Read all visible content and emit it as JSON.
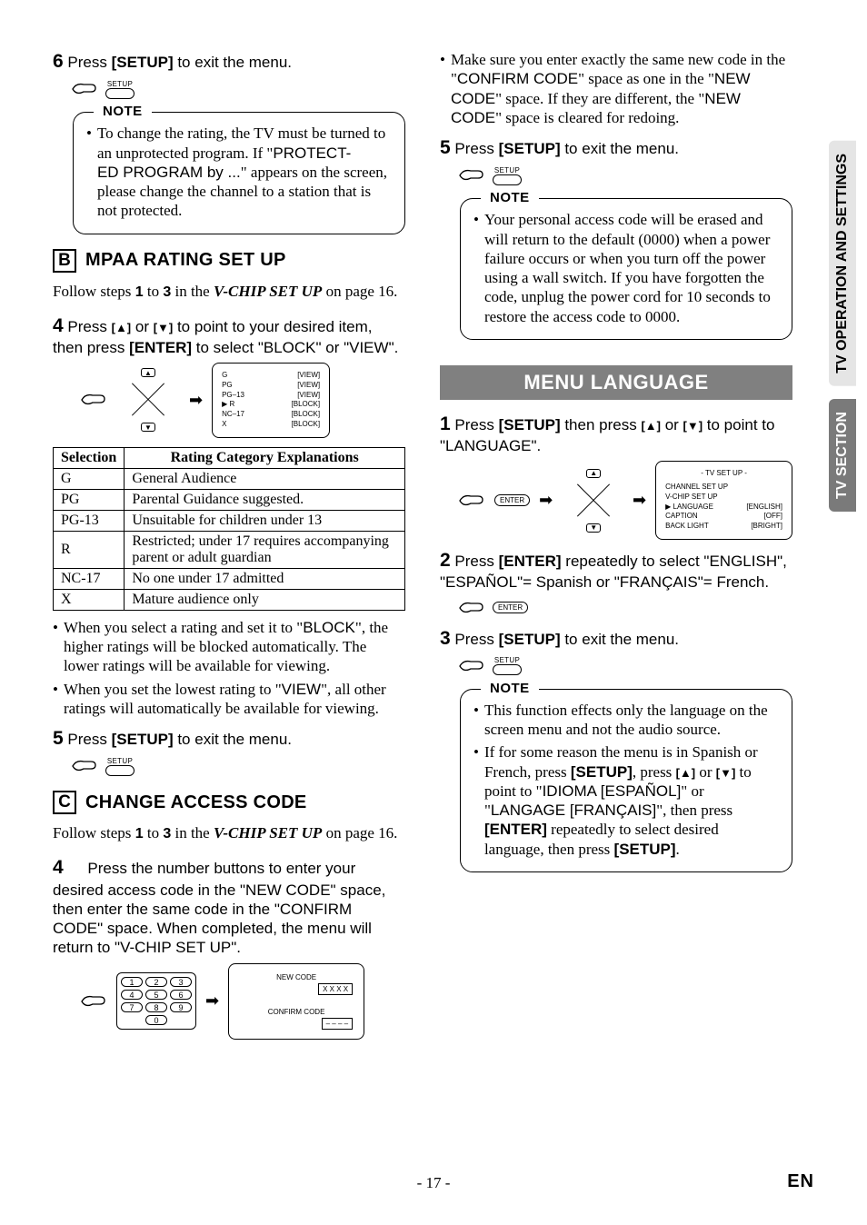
{
  "left": {
    "step6": {
      "num": "6",
      "prefix": "Press ",
      "setup": "[SETUP]",
      "suffix": " to exit the menu."
    },
    "setup_label": "SETUP",
    "note1": {
      "title": "NOTE",
      "body_pre": "To change the rating, the TV must be turned to an unprotected program. If \"",
      "prot1": "PROTECT-",
      "prot2": "ED PROGRAM by ...",
      "body_post": "\" appears on the screen, please change the channel to a station that is not protected."
    },
    "sectionB": {
      "letter": "B",
      "title": "MPAA RATING SET UP"
    },
    "follow": {
      "pre": "Follow steps ",
      "a": "1",
      "mid": " to ",
      "b": "3",
      "mid2": " in the ",
      "vchip": "V-CHIP SET UP",
      "post": " on page 16."
    },
    "step4": {
      "num": "4",
      "line1a": "Press ",
      "up": "[▲]",
      "or": " or ",
      "down": "[▼]",
      "line1b": " to point to your desired item, then press ",
      "enter": "[ENTER]",
      "line1c": " to select \"BLOCK\" or \"VIEW\"."
    },
    "ratings_screen": [
      [
        "G",
        "[VIEW]"
      ],
      [
        "PG",
        "[VIEW]"
      ],
      [
        "PG–13",
        "[VIEW]"
      ],
      [
        "R",
        "[BLOCK]"
      ],
      [
        "NC–17",
        "[BLOCK]"
      ],
      [
        "X",
        "[BLOCK]"
      ]
    ],
    "table": {
      "head": [
        "Selection",
        "Rating Category Explanations"
      ],
      "rows": [
        [
          "G",
          "General Audience"
        ],
        [
          "PG",
          "Parental Guidance suggested."
        ],
        [
          "PG-13",
          "Unsuitable for children under 13"
        ],
        [
          "R",
          "Restricted; under 17 requires accompanying parent or adult guardian"
        ],
        [
          "NC-17",
          "No one under 17 admitted"
        ],
        [
          "X",
          "Mature audience only"
        ]
      ]
    },
    "bullets_after_table": [
      {
        "pre": "When you select a rating and set it to \"",
        "b": "BLOCK",
        "post": "\", the higher ratings will be blocked automatically. The lower ratings will be available for viewing."
      },
      {
        "pre": "When you set the lowest rating to \"",
        "b": "VIEW",
        "post": "\", all other ratings will automatically be available for viewing."
      }
    ],
    "step5": {
      "num": "5",
      "prefix": "Press ",
      "setup": "[SETUP]",
      "suffix": " to exit the menu."
    },
    "sectionC": {
      "letter": "C",
      "title": "CHANGE ACCESS CODE"
    },
    "step4c": {
      "num": "4",
      "text": "Press the number buttons to enter your desired access code in the \"NEW CODE\" space, then enter the same code in the \"CONFIRM CODE\" space. When completed, the menu will return to \"V-CHIP SET UP\"."
    },
    "keypad": [
      "1",
      "2",
      "3",
      "4",
      "5",
      "6",
      "7",
      "8",
      "9",
      "0"
    ],
    "code_screen": {
      "new_label": "NEW CODE",
      "new_value": "X X X X",
      "confirm_label": "CONFIRM CODE",
      "confirm_value": "– – – –"
    }
  },
  "right": {
    "top_bullet": {
      "pre": "Make sure you enter exactly the same new code in the \"",
      "cc": "CONFIRM CODE",
      "mid": "\" space as one in the \"",
      "nc1": "NEW CODE",
      "mid2": "\" space. If they are different, the \"",
      "nc2": "NEW CODE",
      "post": "\" space is cleared for redoing."
    },
    "step5": {
      "num": "5",
      "prefix": "Press ",
      "setup": "[SETUP]",
      "suffix": " to exit the menu."
    },
    "note": {
      "title": "NOTE",
      "body": "Your personal access code will be erased and will return to the default (0000) when a power failure occurs or when you turn off the power using a wall switch. If you have forgotten the code, unplug the power cord for 10 seconds to restore the access code to 0000."
    },
    "banner": "MENU LANGUAGE",
    "step1": {
      "num": "1",
      "pre": "Press ",
      "setup": "[SETUP]",
      "mid": " then press ",
      "up": "[▲]",
      "or": " or ",
      "down": "[▼]",
      "post": " to point to \"LANGUAGE\"."
    },
    "enter_label": "ENTER",
    "tv_screen": {
      "title": "- TV SET UP -",
      "rows": [
        [
          "CHANNEL SET UP",
          ""
        ],
        [
          "V-CHIP SET UP",
          ""
        ],
        [
          "LANGUAGE",
          "[ENGLISH]"
        ],
        [
          "CAPTION",
          "[OFF]"
        ],
        [
          "BACK LIGHT",
          "[BRIGHT]"
        ]
      ]
    },
    "step2": {
      "num": "2",
      "pre": "Press ",
      "enter": "[ENTER]",
      "post": " repeatedly to select \"ENGLISH\", \"ESPAÑOL\"= Spanish or \"FRANÇAIS\"= French."
    },
    "step3": {
      "num": "3",
      "prefix": "Press ",
      "setup": "[SETUP]",
      "suffix": " to exit the menu."
    },
    "note2": {
      "title": "NOTE",
      "bullet1": "This function effects only the language on the screen menu and not the audio source.",
      "bullet2": {
        "a": "If for some reason the menu is in Spanish or French, press ",
        "setup": "[SETUP]",
        "b": ", press ",
        "up": "[▲]",
        "or": " or ",
        "down": "[▼]",
        "c": " to point to \"",
        "idioma": "IDIOMA [ESPAÑOL]",
        "d": "\" or \"",
        "langage": "LANGAGE [FRANÇAIS]",
        "e": "\", then press ",
        "enter": "[ENTER]",
        "f": " repeatedly to select desired language, then press ",
        "setup2": "[SETUP]",
        "g": "."
      }
    }
  },
  "tabs": {
    "top": "TV OPERATION AND SETTINGS",
    "bottom": "TV SECTION"
  },
  "footer": {
    "page": "- 17 -",
    "lang": "EN"
  }
}
